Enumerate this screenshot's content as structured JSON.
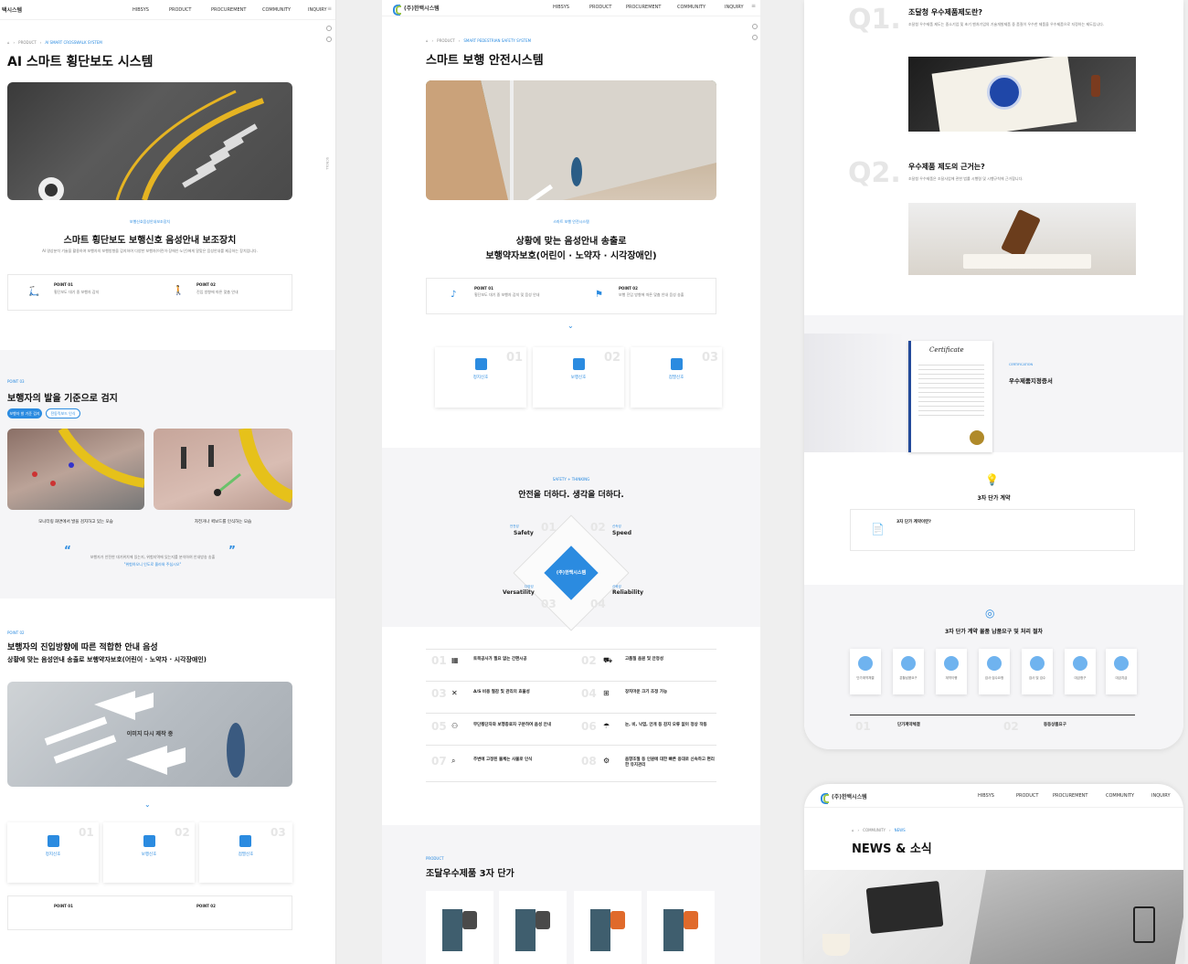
{
  "p1": {
    "nav_brand": "택시스템",
    "menu": [
      "HIBSYS",
      "PRODUCT",
      "PROCUREMENT",
      "COMMUNITY",
      "INQUIRY"
    ],
    "breadcrumb": [
      "PRODUCT",
      "AI SMART CROSSWALK SYSTEM"
    ],
    "title": "AI 스마트 횡단보도 시스템",
    "sub_tag": "보행신호음성안내보조장치",
    "sub_title": "스마트 횡단보도 보행신호 음성안내 보조장치",
    "desc": "AI 영상분석 기술을 활용하여 보행자의 보행방향을 감지하여 다양한 보행자(어린이·장애인·노인)에게 알맞은 음성안내를 제공하는 장치입니다.",
    "points": [
      {
        "label": "POINT 01",
        "text": "횡단보도 대기 중 보행자 감지"
      },
      {
        "label": "POINT 02",
        "text": "진입 방향에 따른 맞춤 안내"
      }
    ],
    "point03_tag": "POINT 03",
    "point03_title": "보행자의 발을 기준으로 검지",
    "tabs": [
      "보행자 발 기준 검지",
      "전동킥보드 인식"
    ],
    "captions": [
      "모니터링 화면에서 발을 검지하고 있는 모습",
      "자전거나 퀵보드를 인식하는 모습"
    ],
    "quote": "보행자가 안전한 대기위치에 있는지, 위험지역에 있는지를 분석하여 안내방송 송출",
    "quote_hl": "\"위험하오니 인도로 올라와 주십시오\"",
    "point02_tag": "POINT 02",
    "point02_title": "보행자의 진입방향에 따른 적합한 안내 음성",
    "point02_sub": "상황에 맞는 음성안내 송출로 보행약자보호(어린이 · 노약자 · 시각장애인)",
    "img_label": "이미지 다시 제작 중",
    "cards": [
      {
        "num": "01",
        "label": "정지신호"
      },
      {
        "num": "02",
        "label": "보행신호"
      },
      {
        "num": "03",
        "label": "점멸신호"
      }
    ],
    "bottom_points": [
      "POINT 01",
      "POINT 02"
    ],
    "side_text": "SCROLL"
  },
  "p2": {
    "nav_brand": "(주)한백시스템",
    "menu": [
      "HIBSYS",
      "PRODUCT",
      "PROCUREMENT",
      "COMMUNITY",
      "INQUIRY"
    ],
    "breadcrumb": [
      "PRODUCT",
      "SMART PEDESTRIAN SAFETY SYSTEM"
    ],
    "title": "스마트 보행 안전시스템",
    "sub_tag": "스마트 보행 안전시스템",
    "sub_title1": "상황에 맞는 음성안내 송출로",
    "sub_title2": "보행약자보호(어린이 · 노약자 · 시각장애인)",
    "points": [
      {
        "label": "POINT 01",
        "text": "횡단보도 대기 중 보행자 감지 및 음성 안내"
      },
      {
        "label": "POINT 02",
        "text": "보행 진입 방향에 따른 맞춤 안내 음성 송출"
      }
    ],
    "cards": [
      {
        "num": "01",
        "label": "정지신호"
      },
      {
        "num": "02",
        "label": "보행신호"
      },
      {
        "num": "03",
        "label": "점멸신호"
      }
    ],
    "safety_tag": "SAFETY + THINKING",
    "safety_title": "안전을 더하다. 생각을 더하다.",
    "diamond_center": "(주)한백시스템",
    "quadrants": [
      {
        "num": "01",
        "ko": "안전성",
        "en": "Safety"
      },
      {
        "num": "02",
        "ko": "신속성",
        "en": "Speed"
      },
      {
        "num": "03",
        "ko": "다양성",
        "en": "Versatility"
      },
      {
        "num": "04",
        "ko": "신뢰성",
        "en": "Reliability"
      }
    ],
    "features": [
      {
        "num": "01",
        "title": "토목공사가 필요 없는 간편시공"
      },
      {
        "num": "02",
        "title": "고품질 음원 및 안정성"
      },
      {
        "num": "03",
        "title": "A/S 비용 절감 및 관리의 효율성"
      },
      {
        "num": "04",
        "title": "장치마운 크기 조정 가능"
      },
      {
        "num": "05",
        "title": "무단횡단자와 보행종료자 구분하여 음성 안내"
      },
      {
        "num": "06",
        "title": "눈, 비, 낙엽, 안개 등 감지 오류 없이 정상 작동"
      },
      {
        "num": "07",
        "title": "주변에 고정된 물체는 사물로 인식"
      },
      {
        "num": "08",
        "title": "음향조절 등 인원에 대한 빠른 응대로 신속하고 편리한 유지관리"
      }
    ],
    "product_tag": "PRODUCT",
    "product_title": "조달우수제품 3자 단가"
  },
  "p3": {
    "q1_num": "Q1.",
    "q1_title": "조달청 우수제품제도란?",
    "q1_text": "조달청 우수제품 제도는 중소기업 및 초기 벤처기업의 기술개발제품 중 품질이 우수한 제품을 우수제품으로 지정하는 제도입니다.",
    "q2_num": "Q2.",
    "q2_title": "우수제품 제도의 근거는?",
    "q2_text": "조달청 우수제품은 조달사업에 관한 법률 시행령 및 시행규칙에 근거합니다.",
    "cert_tag": "CERTIFICATION",
    "cert_title": "우수제품지정증서",
    "cert_doc": "Certificate",
    "contract_title": "3자 단가 계약",
    "contract_q": "3자 단가 계약이란?",
    "process_title": "3자 단가 계약 물품 납품요구 및 처리 절차",
    "steps": [
      "단가계약체결",
      "분할납품요구",
      "계약이행",
      "검사·검수요청",
      "검사 및 검수",
      "대금청구",
      "대금지급"
    ],
    "bottom": [
      {
        "num": "01",
        "title": "단가계약체결"
      },
      {
        "num": "02",
        "title": "동등상품요구"
      }
    ]
  },
  "p4": {
    "nav_brand": "(주)한백시스템",
    "menu": [
      "HIBSYS",
      "PRODUCT",
      "PROCUREMENT",
      "COMMUNITY",
      "INQUIRY"
    ],
    "breadcrumb": [
      "COMMUNITY",
      "NEWS"
    ],
    "title": "NEWS & 소식"
  },
  "colors": {
    "accent": "#2b8be0",
    "green": "#9cc64a"
  }
}
